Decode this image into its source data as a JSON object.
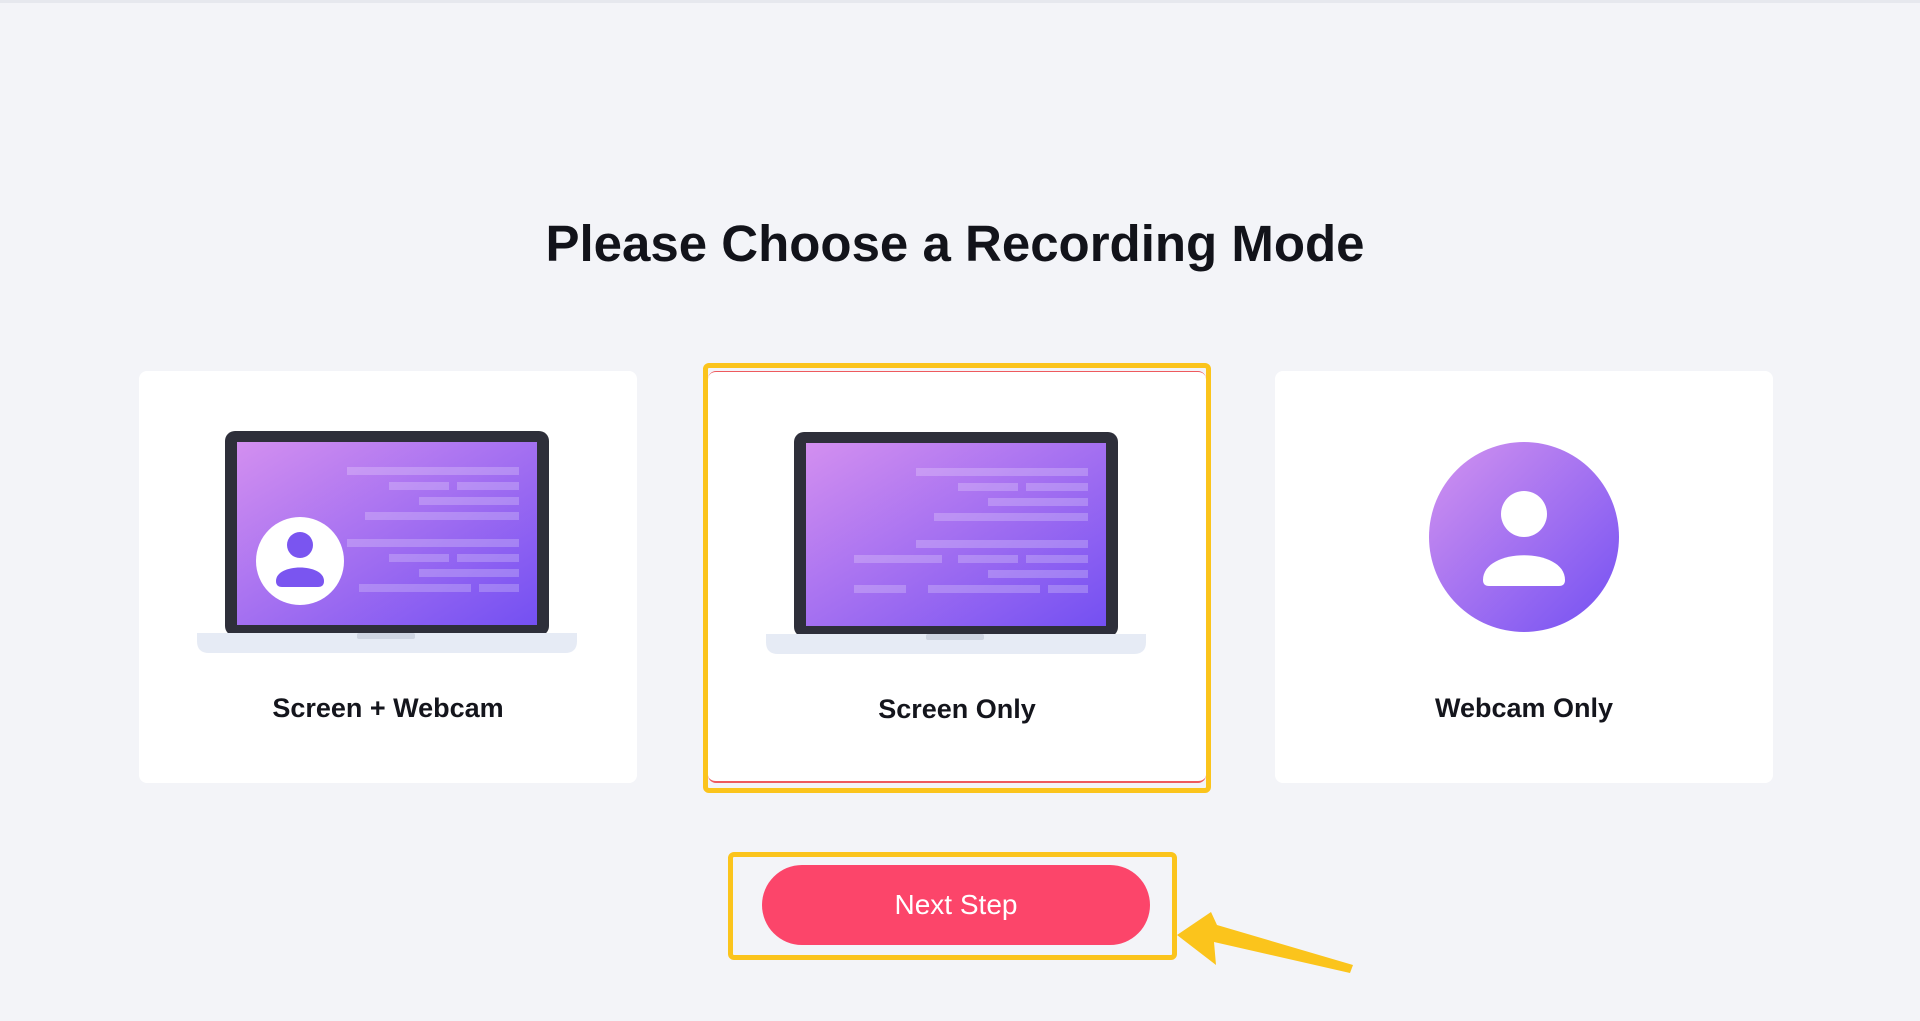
{
  "page": {
    "title": "Please Choose a Recording Mode"
  },
  "modes": [
    {
      "label": "Screen + Webcam",
      "icon": "laptop-with-webcam-avatar-icon",
      "selected": false
    },
    {
      "label": "Screen Only",
      "icon": "laptop-screen-icon",
      "selected": true
    },
    {
      "label": "Webcam Only",
      "icon": "webcam-avatar-icon",
      "selected": false
    }
  ],
  "actions": {
    "next_label": "Next Step"
  },
  "colors": {
    "background": "#f3f4f8",
    "card": "#ffffff",
    "accent_button": "#fc456a",
    "highlight": "#fbc41c",
    "purple_start": "#d18ef0",
    "purple_end": "#7552f2",
    "laptop_frame": "#2e2f3a"
  }
}
